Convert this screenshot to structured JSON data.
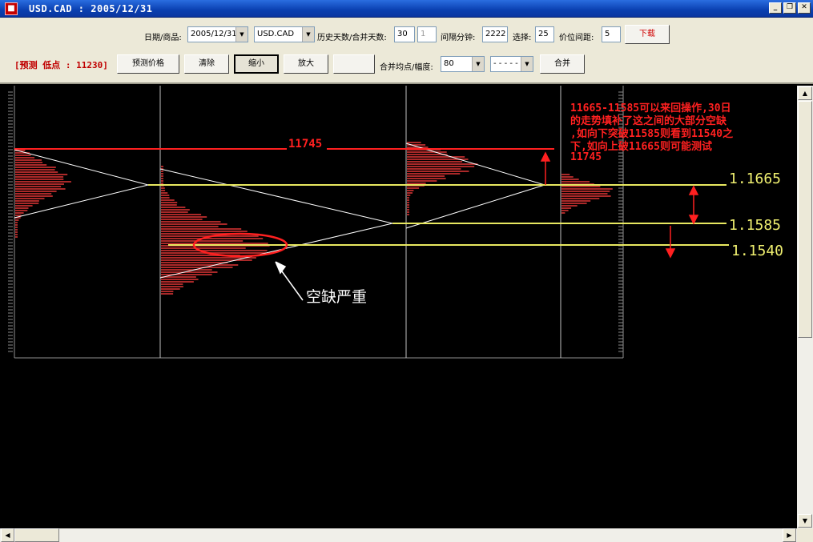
{
  "window": {
    "title": "USD.CAD : 2005/12/31",
    "icon": "app-logo-icon",
    "minimize_icon": "minimize-icon",
    "restore_icon": "restore-icon",
    "close_icon": "close-icon"
  },
  "toolbar": {
    "date_label": "日期/商品:",
    "date_value": "2005/12/31",
    "symbol_value": "USD.CAD",
    "history_label": "历史天数/合并天数:",
    "history_days": "30",
    "merge_days": "1",
    "interval_label": "间隔分钟:",
    "interval_value": "2222",
    "select_label": "选择:",
    "select_value": "25",
    "price_spacing_label": "价位间距:",
    "price_spacing_value": "5",
    "download_label": "下载",
    "forecast_text": "[预测 低点 : 11230]",
    "predict_price_label": "预测价格",
    "clear_label": "清除",
    "zoom_out_label": "缩小",
    "zoom_in_label": "放大",
    "blank_label": "",
    "merge_avg_label": "合并均点/幅度:",
    "merge_avg_value": "80",
    "line_style_value": "- - - - -",
    "merge_label": "合并"
  },
  "chart": {
    "level_11745": "11745",
    "level_1_1665": "1.1665",
    "level_1_1585": "1.1585",
    "level_1_1540": "1.1540",
    "annotation_lines": [
      "11665-11585可以来回操作,30日",
      "的走势填补了这之间的大部分空缺",
      ",如向下突破11585则看到11540之",
      "下,如向上破11665则可能测试",
      "11745"
    ],
    "gap_label": "空缺严重",
    "colors": {
      "profile": "#c83030",
      "level_line": "#e8e860",
      "annotation": "#ff2020",
      "guide": "#ffffff"
    }
  }
}
